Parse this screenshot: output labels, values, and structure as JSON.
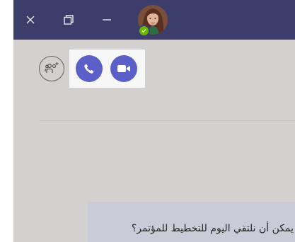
{
  "window": {
    "controls": {
      "close_icon": "close-icon",
      "restore_icon": "restore-icon",
      "minimize_icon": "minimize-icon"
    },
    "avatar": {
      "presence": "available",
      "presence_color": "#6bb700"
    }
  },
  "toolbar": {
    "add_people_icon": "add-people-icon",
    "audio_call_icon": "phone-icon",
    "video_call_icon": "video-camera-icon"
  },
  "chat": {
    "message_text": "يمكن أن نلتقي اليوم للتخطيط للمؤتمر؟"
  },
  "colors": {
    "titlebar": "#3c3d6b",
    "accent": "#5b5fc7",
    "background": "#d2d1d0",
    "message_bubble": "#c9cbd7"
  }
}
